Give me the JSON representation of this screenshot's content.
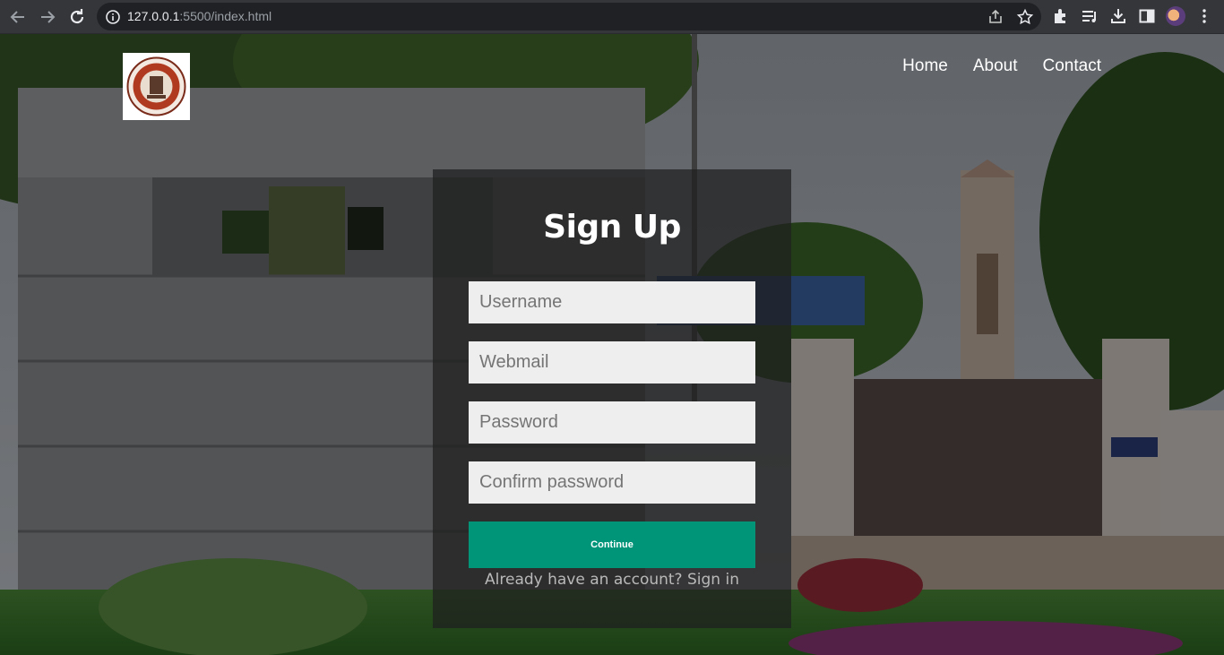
{
  "browser": {
    "url_host": "127.0.0.1",
    "url_rest": ":5500/index.html"
  },
  "icons": {
    "back": "arrow-left-icon",
    "forward": "arrow-right-icon",
    "reload": "reload-icon",
    "site_info": "info-icon",
    "share": "share-icon",
    "bookmark": "star-icon",
    "extensions": "puzzle-icon",
    "reading_list": "reading-list-icon",
    "downloads": "download-icon",
    "side_panel": "side-panel-icon",
    "profile": "avatar",
    "menu": "kebab-menu-icon"
  },
  "nav": {
    "items": [
      "Home",
      "About",
      "Contact"
    ]
  },
  "form": {
    "title": "Sign Up",
    "username_placeholder": "Username",
    "webmail_placeholder": "Webmail",
    "password_placeholder": "Password",
    "confirm_placeholder": "Confirm password",
    "continue_label": "Continue",
    "signin_prefix": "Already have an account?",
    "signin_link": "Sign in"
  },
  "colors": {
    "accent": "#009479",
    "form_bg": "rgba(30,30,30,0.72)",
    "input_bg": "#eeeeee"
  }
}
